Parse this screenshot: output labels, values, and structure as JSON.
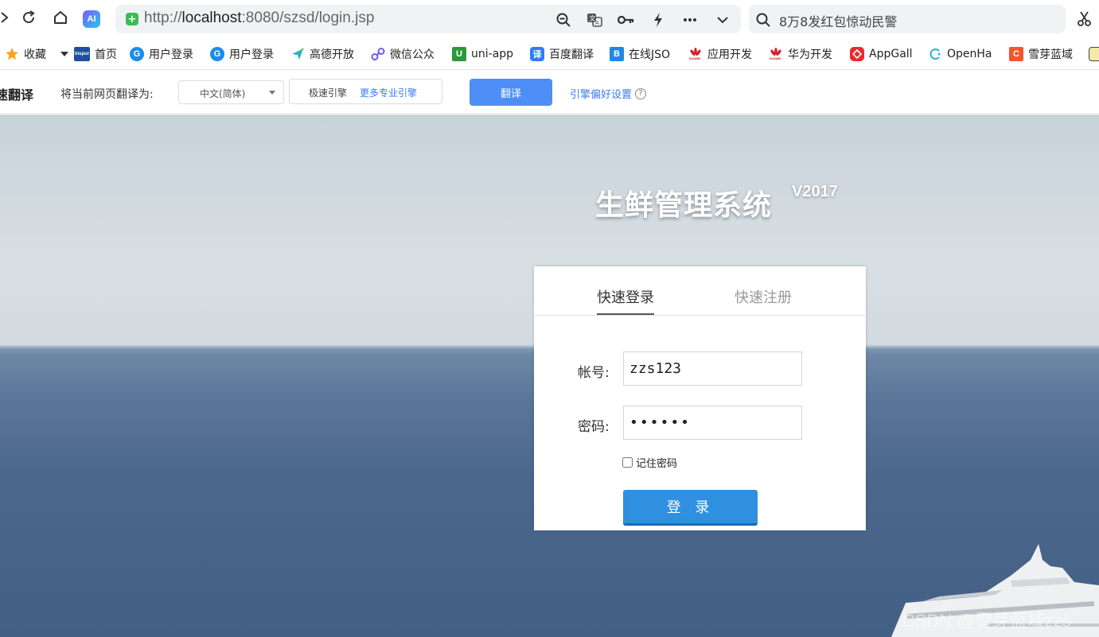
{
  "browser": {
    "url_prefix": "http://",
    "url_host": "localhost",
    "url_rest": ":8080/szsd/login.jsp",
    "ai_label": "AI",
    "search_text": "8万8发红包惊动民警"
  },
  "bookmarks": [
    {
      "label": "收藏",
      "icon": "star-icon",
      "color": "#f5a623"
    },
    {
      "label": "首页",
      "icon": "inspur-icon",
      "color": "#1e4fa0"
    },
    {
      "label": "用户登录",
      "icon": "globe-icon",
      "color": "#1a8ceb"
    },
    {
      "label": "用户登录",
      "icon": "globe-icon",
      "color": "#1a8ceb"
    },
    {
      "label": "高德开放",
      "icon": "amap-icon",
      "color": "#29a3e8"
    },
    {
      "label": "微信公众",
      "icon": "link-icon",
      "color": "#6c5ce7"
    },
    {
      "label": "uni-app",
      "icon": "uniapp-icon",
      "color": "#2b9939"
    },
    {
      "label": "百度翻译",
      "icon": "baidu-translate-icon",
      "color": "#2e7df6"
    },
    {
      "label": "在线JSO",
      "icon": "json-icon",
      "color": "#1e88e5"
    },
    {
      "label": "应用开发",
      "icon": "huawei-icon",
      "color": "#d71e2a"
    },
    {
      "label": "华为开发",
      "icon": "huawei-icon",
      "color": "#d71e2a"
    },
    {
      "label": "AppGall",
      "icon": "appgallery-icon",
      "color": "#e52d2d"
    },
    {
      "label": "OpenHa",
      "icon": "openharmony-icon",
      "color": "#2bb3c0"
    },
    {
      "label": "雪芽蓝域",
      "icon": "csdn-icon",
      "color": "#f2572c"
    }
  ],
  "translate_bar": {
    "title": "速翻译",
    "label": "将当前网页翻译为:",
    "language": "中文(简体)",
    "engine": "极速引擎",
    "more_engines": "更多专业引擎",
    "translate_button": "翻译",
    "preference": "引擎偏好设置",
    "help": "?"
  },
  "page": {
    "title": "生鲜管理系统",
    "version": "V2017",
    "tabs": {
      "active": "快速登录",
      "inactive": "快速注册"
    },
    "account_label": "帐号:",
    "account_value": "zzs123",
    "password_label": "密码:",
    "password_value": "123456",
    "remember_label": "记住密码",
    "login_button": "登 录",
    "watermark": "CSDN @雪芽蓝域zzs"
  }
}
